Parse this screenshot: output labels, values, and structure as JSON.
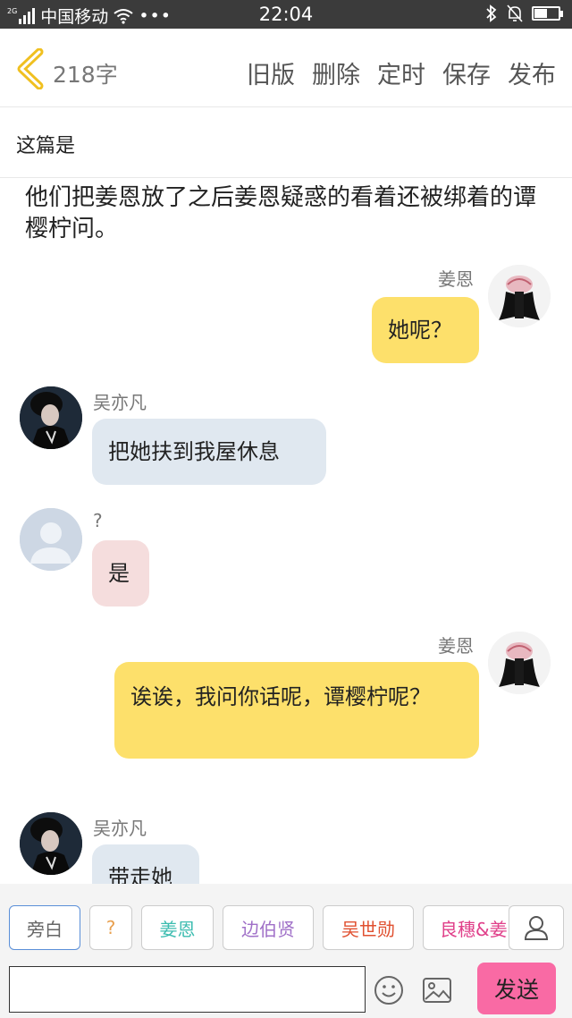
{
  "status_bar": {
    "carrier": "中国移动",
    "time": "22:04",
    "signal_label": "2G"
  },
  "header": {
    "word_count": "218字",
    "actions": [
      "旧版",
      "删除",
      "定时",
      "保存",
      "发布"
    ]
  },
  "title": "这篇是",
  "narration": "他们把姜恩放了之后姜恩疑惑的看着还被绑着的谭樱柠问。",
  "messages": [
    {
      "sender": "姜恩",
      "text": "她呢？",
      "side": "right",
      "color": "yellow"
    },
    {
      "sender": "吴亦凡",
      "text": "把她扶到我屋休息",
      "side": "left",
      "color": "blue"
    },
    {
      "sender": "?",
      "text": "是",
      "side": "left",
      "color": "pink"
    },
    {
      "sender": "姜恩",
      "text": "诶诶，我问你话呢，谭樱柠呢？",
      "side": "right",
      "color": "yellow"
    },
    {
      "sender": "吴亦凡",
      "text": "带走她",
      "side": "left",
      "color": "blue"
    }
  ],
  "characters": [
    {
      "label": "旁白",
      "color": "#666666"
    },
    {
      "label": "?",
      "color": "#e8a050"
    },
    {
      "label": "姜恩",
      "color": "#3cbcb0"
    },
    {
      "label": "边伯贤",
      "color": "#a070c8"
    },
    {
      "label": "吴世勋",
      "color": "#e05030"
    },
    {
      "label": "良穗&姜",
      "color": "#e0408a"
    }
  ],
  "send_label": "发送",
  "colors": {
    "yellow_bubble": "#fde06b",
    "blue_bubble": "#e0e8f0",
    "pink_bubble": "#f5dddd",
    "send_button": "#f96aa4",
    "back_arrow": "#f0c020"
  },
  "icons": [
    "back-arrow-icon",
    "wifi-icon",
    "bluetooth-icon",
    "bell-off-icon",
    "battery-icon",
    "add-character-icon",
    "emoji-icon",
    "image-icon"
  ]
}
